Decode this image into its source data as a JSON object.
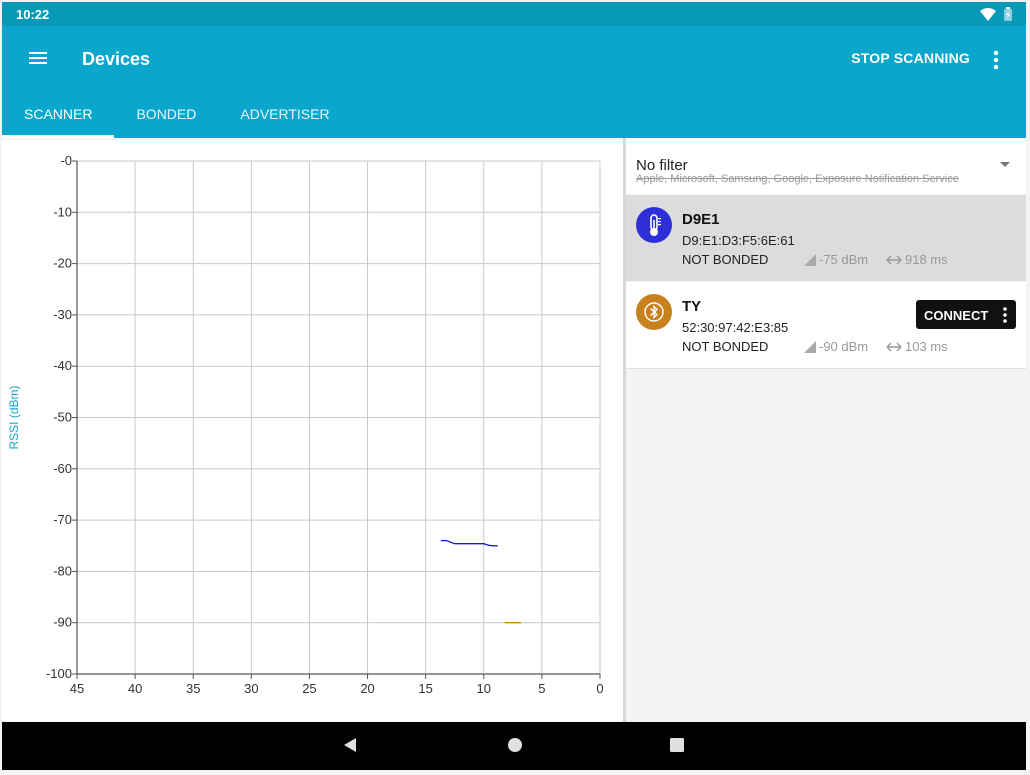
{
  "status_bar": {
    "time": "10:22"
  },
  "app_bar": {
    "title": "Devices",
    "stop_label": "STOP SCANNING"
  },
  "tabs": [
    {
      "label": "SCANNER",
      "active": true
    },
    {
      "label": "BONDED",
      "active": false
    },
    {
      "label": "ADVERTISER",
      "active": false
    }
  ],
  "filter": {
    "title": "No filter",
    "subtitle": "Apple, Microsoft, Samsung, Google, Exposure Notification Service"
  },
  "devices": [
    {
      "name": "D9E1",
      "address": "D9:E1:D3:F5:6E:61",
      "bond_state": "NOT BONDED",
      "rssi": "-75 dBm",
      "interval": "918 ms",
      "icon": "thermometer-icon",
      "icon_color": "#2f2fd8",
      "selected": true
    },
    {
      "name": "TY",
      "address": "52:30:97:42:E3:85",
      "bond_state": "NOT BONDED",
      "rssi": "-90 dBm",
      "interval": "103 ms",
      "icon": "bluetooth-icon",
      "icon_color": "#c8811d",
      "connect_label": "CONNECT",
      "selected": false
    }
  ],
  "chart_data": {
    "type": "line",
    "ylabel": "RSSI (dBm)",
    "xlabel": "",
    "xlim": [
      45,
      0
    ],
    "ylim": [
      -100,
      0
    ],
    "x_ticks": [
      "45",
      "40",
      "35",
      "30",
      "25",
      "20",
      "15",
      "10",
      "5",
      "0"
    ],
    "y_ticks": [
      "-0",
      "-10",
      "-20",
      "-30",
      "-40",
      "-50",
      "-60",
      "-70",
      "-80",
      "-90",
      "-100"
    ],
    "grid": true,
    "series": [
      {
        "color": "#1a1ad6",
        "x": [
          13.7,
          13.2,
          12.5,
          11.5,
          10.0,
          9.6,
          9.2,
          8.8
        ],
        "y": [
          -74.0,
          -74.0,
          -74.6,
          -74.6,
          -74.6,
          -74.9,
          -75.0,
          -75.0
        ]
      },
      {
        "color": "#d6861a",
        "x": [
          8.2,
          7.5,
          6.8
        ],
        "y": [
          -90.0,
          -90.0,
          -90.0
        ]
      }
    ]
  },
  "colors": {
    "app_bar": "#0aa6cb",
    "status_bar": "#0898b8",
    "axis_label": "#1aa3cc"
  }
}
